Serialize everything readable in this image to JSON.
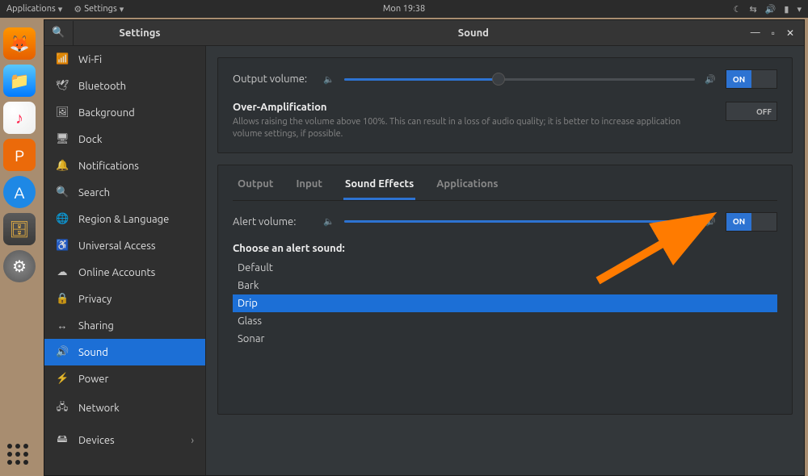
{
  "topbar": {
    "applications": "Applications",
    "settings": "Settings",
    "clock": "Mon 19:38"
  },
  "dock": {
    "firefox": "firefox",
    "finder": "files-manager",
    "music": "music",
    "presentation": "presentation",
    "appstore": "software-center",
    "archive": "archive-manager",
    "settings": "system-settings"
  },
  "window": {
    "sidebar_title": "Settings",
    "panel_title": "Sound",
    "sidebar": [
      {
        "icon": "📶",
        "label": "Wi-Fi"
      },
      {
        "icon": "🕊",
        "label": "Bluetooth"
      },
      {
        "icon": "🖼",
        "label": "Background"
      },
      {
        "icon": "🖥",
        "label": "Dock"
      },
      {
        "icon": "🔔",
        "label": "Notifications"
      },
      {
        "icon": "🔍",
        "label": "Search"
      },
      {
        "icon": "🌐",
        "label": "Region & Language"
      },
      {
        "icon": "♿",
        "label": "Universal Access"
      },
      {
        "icon": "☁",
        "label": "Online Accounts"
      },
      {
        "icon": "🔒",
        "label": "Privacy"
      },
      {
        "icon": "↔",
        "label": "Sharing"
      },
      {
        "icon": "🔊",
        "label": "Sound",
        "active": true
      },
      {
        "icon": "⚡",
        "label": "Power"
      },
      {
        "icon": "🖧",
        "label": "Network"
      },
      {
        "icon": "🖴",
        "label": "Devices",
        "chevron": true
      }
    ]
  },
  "sound": {
    "output_volume_label": "Output volume:",
    "output_volume_percent": 44,
    "output_switch": "ON",
    "overamp": {
      "title": "Over-Amplification",
      "desc": "Allows raising the volume above 100%. This can result in a loss of audio quality; it is better to increase application volume settings, if possible.",
      "switch": "OFF"
    },
    "tabs": [
      "Output",
      "Input",
      "Sound Effects",
      "Applications"
    ],
    "active_tab": "Sound Effects",
    "alert_volume_label": "Alert volume:",
    "alert_volume_percent": 100,
    "alert_switch": "ON",
    "choose_label": "Choose an alert sound:",
    "alert_sounds": [
      "Default",
      "Bark",
      "Drip",
      "Glass",
      "Sonar"
    ],
    "selected_sound": "Drip"
  },
  "switch_labels": {
    "on": "ON",
    "off": "OFF"
  }
}
